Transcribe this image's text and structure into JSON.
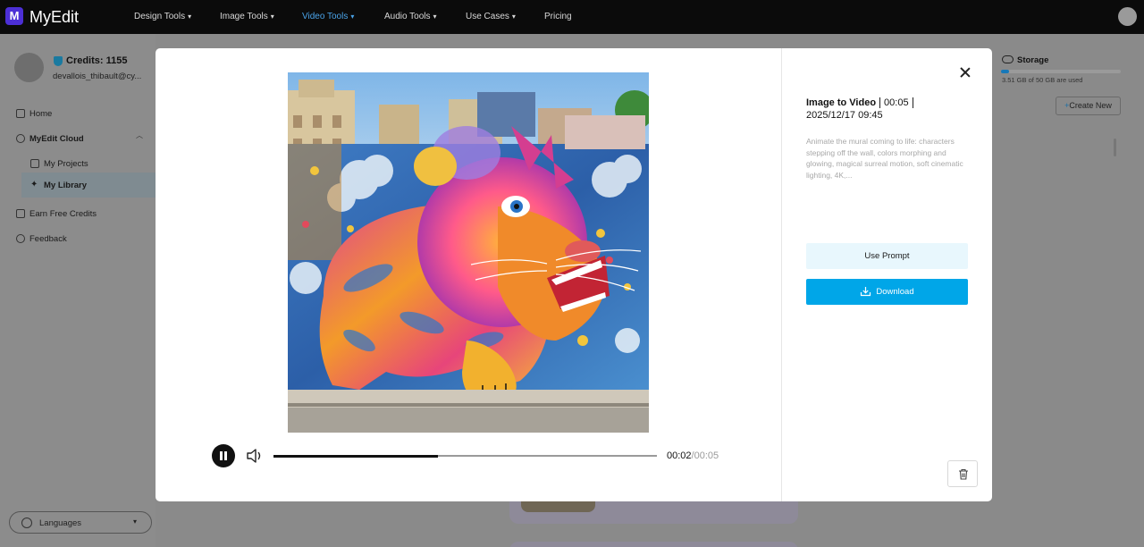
{
  "app": {
    "name": "MyEdit",
    "logo_letter": "M"
  },
  "nav": {
    "items": [
      {
        "label": "Design Tools",
        "dropdown": true
      },
      {
        "label": "Image Tools",
        "dropdown": true
      },
      {
        "label": "Video Tools",
        "dropdown": true,
        "active": true
      },
      {
        "label": "Audio Tools",
        "dropdown": true
      },
      {
        "label": "Use Cases",
        "dropdown": true
      },
      {
        "label": "Pricing",
        "dropdown": false
      }
    ]
  },
  "sidebar": {
    "credits": "Credits: 1155",
    "email": "devallois_thibault@cy...",
    "items": [
      {
        "label": "Home",
        "icon": "home-icon"
      },
      {
        "label": "MyEdit Cloud",
        "icon": "cloud-icon"
      },
      {
        "label": "My Projects",
        "icon": "projects-icon"
      },
      {
        "label": "My Library",
        "icon": "library-icon",
        "selected": true
      },
      {
        "label": "Earn Free Credits",
        "icon": "gift-icon"
      },
      {
        "label": "Feedback",
        "icon": "feedback-icon"
      }
    ],
    "language_label": "Languages"
  },
  "storage": {
    "title": "Storage",
    "used_text": "3.51 GB of 50 GB are used",
    "used_fraction": 0.07
  },
  "create_new_label": "Create New",
  "modal": {
    "kind": "Image to Video",
    "duration": "00:05",
    "created": "2025/12/17 09:45",
    "prompt": "Animate the mural coming to life: characters stepping off the wall, colors morphing and glowing, magical surreal motion, soft cinematic lighting, 4K,...",
    "use_prompt_label": "Use Prompt",
    "download_label": "Download",
    "player": {
      "current_time": "00:02",
      "total_time": "/00:05",
      "progress": 0.43,
      "state": "playing"
    }
  },
  "colors": {
    "accent": "#00a6e8",
    "nav_active": "#4aa3e8",
    "use_prompt_bg": "#e8f7fd",
    "topbar": "#0b0b0b"
  }
}
